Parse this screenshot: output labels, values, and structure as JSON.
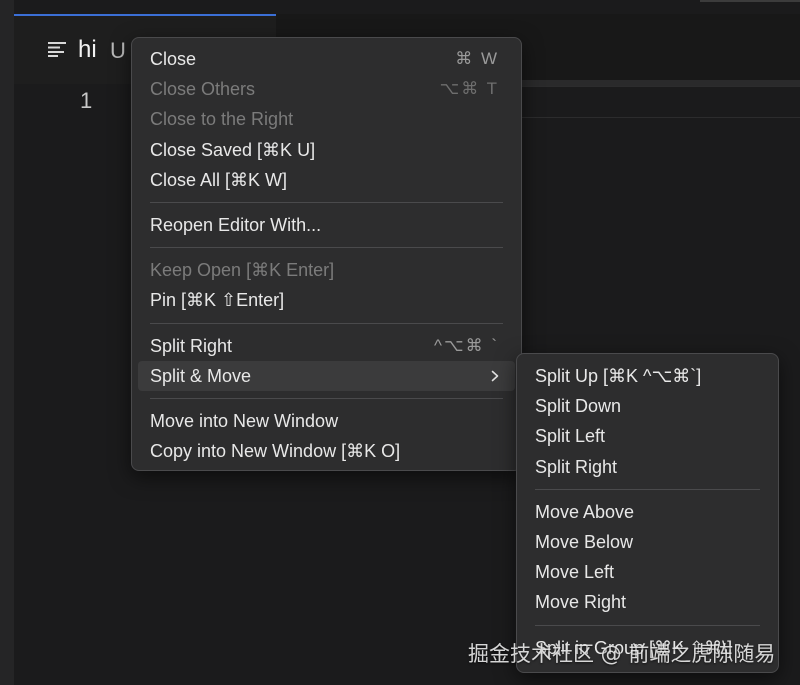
{
  "editor": {
    "tab_title": "hi",
    "tab_status": "U",
    "line_number": "1"
  },
  "context_menu": {
    "items": [
      {
        "label": "Close",
        "shortcut": "⌘ W",
        "disabled": false
      },
      {
        "label": "Close Others",
        "shortcut": "⌥⌘ T",
        "disabled": true
      },
      {
        "label": "Close to the Right",
        "shortcut": "",
        "disabled": true
      },
      {
        "label": "Close Saved [⌘K U]",
        "shortcut": "",
        "disabled": false
      },
      {
        "label": "Close All [⌘K W]",
        "shortcut": "",
        "disabled": false
      },
      {
        "label": "Reopen Editor With...",
        "shortcut": "",
        "disabled": false
      },
      {
        "label": "Keep Open [⌘K Enter]",
        "shortcut": "",
        "disabled": true
      },
      {
        "label": "Pin [⌘K ⇧Enter]",
        "shortcut": "",
        "disabled": false
      },
      {
        "label": "Split Right",
        "shortcut": "^⌥⌘ `",
        "disabled": false
      },
      {
        "label": "Split & Move",
        "shortcut": "",
        "disabled": false,
        "highlighted": true,
        "has_submenu": true
      },
      {
        "label": "Move into New Window",
        "shortcut": "",
        "disabled": false
      },
      {
        "label": "Copy into New Window [⌘K O]",
        "shortcut": "",
        "disabled": false
      }
    ]
  },
  "submenu": {
    "items": [
      {
        "label": "Split Up [⌘K ^⌥⌘`]"
      },
      {
        "label": "Split Down"
      },
      {
        "label": "Split Left"
      },
      {
        "label": "Split Right"
      },
      {
        "label": "Move Above"
      },
      {
        "label": "Move Below"
      },
      {
        "label": "Move Left"
      },
      {
        "label": "Move Right"
      },
      {
        "label": "Split in Group [⌘K ⇧⌘\\]"
      }
    ]
  },
  "watermark": "掘金技术社区 @ 前端之虎陈随易",
  "colors": {
    "accent": "#3b6fd6",
    "menu_bg": "#2d2d2e",
    "editor_bg": "#1b1b1c"
  }
}
